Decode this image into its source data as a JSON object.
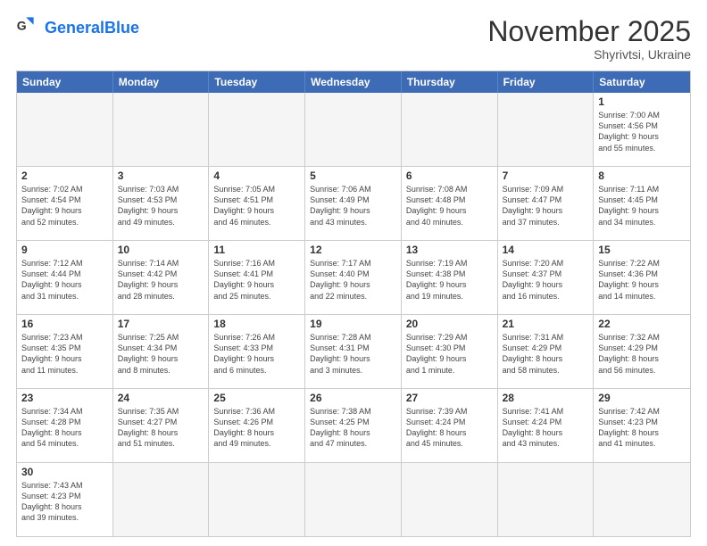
{
  "header": {
    "logo_general": "General",
    "logo_blue": "Blue",
    "month_title": "November 2025",
    "subtitle": "Shyrivtsi, Ukraine"
  },
  "weekdays": [
    "Sunday",
    "Monday",
    "Tuesday",
    "Wednesday",
    "Thursday",
    "Friday",
    "Saturday"
  ],
  "rows": [
    [
      {
        "day": "",
        "info": "",
        "empty": true
      },
      {
        "day": "",
        "info": "",
        "empty": true
      },
      {
        "day": "",
        "info": "",
        "empty": true
      },
      {
        "day": "",
        "info": "",
        "empty": true
      },
      {
        "day": "",
        "info": "",
        "empty": true
      },
      {
        "day": "",
        "info": "",
        "empty": true
      },
      {
        "day": "1",
        "info": "Sunrise: 7:00 AM\nSunset: 4:56 PM\nDaylight: 9 hours\nand 55 minutes.",
        "empty": false
      }
    ],
    [
      {
        "day": "2",
        "info": "Sunrise: 7:02 AM\nSunset: 4:54 PM\nDaylight: 9 hours\nand 52 minutes.",
        "empty": false
      },
      {
        "day": "3",
        "info": "Sunrise: 7:03 AM\nSunset: 4:53 PM\nDaylight: 9 hours\nand 49 minutes.",
        "empty": false
      },
      {
        "day": "4",
        "info": "Sunrise: 7:05 AM\nSunset: 4:51 PM\nDaylight: 9 hours\nand 46 minutes.",
        "empty": false
      },
      {
        "day": "5",
        "info": "Sunrise: 7:06 AM\nSunset: 4:49 PM\nDaylight: 9 hours\nand 43 minutes.",
        "empty": false
      },
      {
        "day": "6",
        "info": "Sunrise: 7:08 AM\nSunset: 4:48 PM\nDaylight: 9 hours\nand 40 minutes.",
        "empty": false
      },
      {
        "day": "7",
        "info": "Sunrise: 7:09 AM\nSunset: 4:47 PM\nDaylight: 9 hours\nand 37 minutes.",
        "empty": false
      },
      {
        "day": "8",
        "info": "Sunrise: 7:11 AM\nSunset: 4:45 PM\nDaylight: 9 hours\nand 34 minutes.",
        "empty": false
      }
    ],
    [
      {
        "day": "9",
        "info": "Sunrise: 7:12 AM\nSunset: 4:44 PM\nDaylight: 9 hours\nand 31 minutes.",
        "empty": false
      },
      {
        "day": "10",
        "info": "Sunrise: 7:14 AM\nSunset: 4:42 PM\nDaylight: 9 hours\nand 28 minutes.",
        "empty": false
      },
      {
        "day": "11",
        "info": "Sunrise: 7:16 AM\nSunset: 4:41 PM\nDaylight: 9 hours\nand 25 minutes.",
        "empty": false
      },
      {
        "day": "12",
        "info": "Sunrise: 7:17 AM\nSunset: 4:40 PM\nDaylight: 9 hours\nand 22 minutes.",
        "empty": false
      },
      {
        "day": "13",
        "info": "Sunrise: 7:19 AM\nSunset: 4:38 PM\nDaylight: 9 hours\nand 19 minutes.",
        "empty": false
      },
      {
        "day": "14",
        "info": "Sunrise: 7:20 AM\nSunset: 4:37 PM\nDaylight: 9 hours\nand 16 minutes.",
        "empty": false
      },
      {
        "day": "15",
        "info": "Sunrise: 7:22 AM\nSunset: 4:36 PM\nDaylight: 9 hours\nand 14 minutes.",
        "empty": false
      }
    ],
    [
      {
        "day": "16",
        "info": "Sunrise: 7:23 AM\nSunset: 4:35 PM\nDaylight: 9 hours\nand 11 minutes.",
        "empty": false
      },
      {
        "day": "17",
        "info": "Sunrise: 7:25 AM\nSunset: 4:34 PM\nDaylight: 9 hours\nand 8 minutes.",
        "empty": false
      },
      {
        "day": "18",
        "info": "Sunrise: 7:26 AM\nSunset: 4:33 PM\nDaylight: 9 hours\nand 6 minutes.",
        "empty": false
      },
      {
        "day": "19",
        "info": "Sunrise: 7:28 AM\nSunset: 4:31 PM\nDaylight: 9 hours\nand 3 minutes.",
        "empty": false
      },
      {
        "day": "20",
        "info": "Sunrise: 7:29 AM\nSunset: 4:30 PM\nDaylight: 9 hours\nand 1 minute.",
        "empty": false
      },
      {
        "day": "21",
        "info": "Sunrise: 7:31 AM\nSunset: 4:29 PM\nDaylight: 8 hours\nand 58 minutes.",
        "empty": false
      },
      {
        "day": "22",
        "info": "Sunrise: 7:32 AM\nSunset: 4:29 PM\nDaylight: 8 hours\nand 56 minutes.",
        "empty": false
      }
    ],
    [
      {
        "day": "23",
        "info": "Sunrise: 7:34 AM\nSunset: 4:28 PM\nDaylight: 8 hours\nand 54 minutes.",
        "empty": false
      },
      {
        "day": "24",
        "info": "Sunrise: 7:35 AM\nSunset: 4:27 PM\nDaylight: 8 hours\nand 51 minutes.",
        "empty": false
      },
      {
        "day": "25",
        "info": "Sunrise: 7:36 AM\nSunset: 4:26 PM\nDaylight: 8 hours\nand 49 minutes.",
        "empty": false
      },
      {
        "day": "26",
        "info": "Sunrise: 7:38 AM\nSunset: 4:25 PM\nDaylight: 8 hours\nand 47 minutes.",
        "empty": false
      },
      {
        "day": "27",
        "info": "Sunrise: 7:39 AM\nSunset: 4:24 PM\nDaylight: 8 hours\nand 45 minutes.",
        "empty": false
      },
      {
        "day": "28",
        "info": "Sunrise: 7:41 AM\nSunset: 4:24 PM\nDaylight: 8 hours\nand 43 minutes.",
        "empty": false
      },
      {
        "day": "29",
        "info": "Sunrise: 7:42 AM\nSunset: 4:23 PM\nDaylight: 8 hours\nand 41 minutes.",
        "empty": false
      }
    ],
    [
      {
        "day": "30",
        "info": "Sunrise: 7:43 AM\nSunset: 4:23 PM\nDaylight: 8 hours\nand 39 minutes.",
        "empty": false
      },
      {
        "day": "",
        "info": "",
        "empty": true
      },
      {
        "day": "",
        "info": "",
        "empty": true
      },
      {
        "day": "",
        "info": "",
        "empty": true
      },
      {
        "day": "",
        "info": "",
        "empty": true
      },
      {
        "day": "",
        "info": "",
        "empty": true
      },
      {
        "day": "",
        "info": "",
        "empty": true
      }
    ]
  ]
}
